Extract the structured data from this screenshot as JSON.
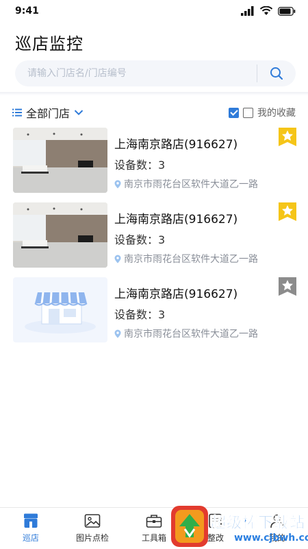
{
  "status": {
    "time": "9:41"
  },
  "page": {
    "title": "巡店监控"
  },
  "search": {
    "placeholder": "请输入门店名/门店编号",
    "value": ""
  },
  "filter": {
    "scope_label": "全部门店",
    "favorites_label": "我的收藏",
    "favorites_checked": true
  },
  "stores": [
    {
      "name": "上海南京路店(916627)",
      "devices": "设备数：3",
      "address": "南京市雨花台区软件大道乙一路",
      "thumb": "office-photo",
      "favorite": true
    },
    {
      "name": "上海南京路店(916627)",
      "devices": "设备数：3",
      "address": "南京市雨花台区软件大道乙一路",
      "thumb": "office-photo",
      "favorite": true
    },
    {
      "name": "上海南京路店(916627)",
      "devices": "设备数：3",
      "address": "南京市雨花台区软件大道乙一路",
      "thumb": "store-placeholder",
      "favorite": false
    }
  ],
  "tabs": [
    {
      "label": "巡店",
      "icon": "store-icon",
      "active": true
    },
    {
      "label": "图片点检",
      "icon": "image-icon",
      "active": false
    },
    {
      "label": "工具箱",
      "icon": "toolbox-icon",
      "active": false
    },
    {
      "label": "整改",
      "icon": "rectify-icon",
      "active": false
    },
    {
      "label": "我的",
      "icon": "user-icon",
      "active": false
    }
  ],
  "watermark": {
    "text": "超级棒下载站",
    "url": "www.cjbwh.com"
  },
  "colors": {
    "accent": "#2f7bd9",
    "star_active": "#f5c518",
    "star_inactive": "#8c8c8c",
    "address": "#8a8f99"
  }
}
